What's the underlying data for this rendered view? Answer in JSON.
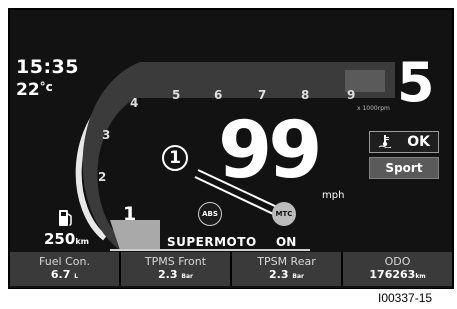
{
  "status": {
    "clock": "15:35",
    "temperature": "22",
    "temperature_unit": "°c",
    "gear": "5",
    "rpm_unit": "x 1000rpm"
  },
  "tachometer": {
    "ticks": [
      "1",
      "2",
      "3",
      "4",
      "5",
      "6",
      "7",
      "8",
      "9"
    ],
    "current_rpm_x1000": 1
  },
  "speed": {
    "value": "99",
    "unit": "mph"
  },
  "indicators": {
    "ok_label": "OK",
    "mode_label": "Sport",
    "abs_label": "ABS",
    "mtc_label": "MTC",
    "riding_mode": "SUPERMOTO",
    "mtc_state": "ON"
  },
  "fuel": {
    "range": "250",
    "range_unit": "km"
  },
  "callout": {
    "number": "1"
  },
  "info_bar": [
    {
      "label": "Fuel Con.",
      "value": "6.7",
      "unit": "L"
    },
    {
      "label": "TPMS Front",
      "value": "2.3",
      "unit": "Bar"
    },
    {
      "label": "TPSM Rear",
      "value": "2.3",
      "unit": "Bar"
    },
    {
      "label": "ODO",
      "value": "176263",
      "unit": "km"
    }
  ],
  "figure_code": "I00337-15",
  "colors": {
    "background": "#121212",
    "panel": "#3a3a3a",
    "accent": "#ffffff",
    "mtc_badge": "#bcbcbc"
  }
}
